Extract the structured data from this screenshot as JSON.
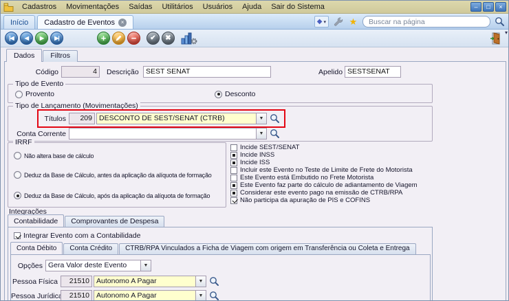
{
  "colors": {
    "menubar_bg": "#d8d3a6",
    "accent_blue": "#2d6cb5",
    "field_yellow": "#ffffce",
    "code_field_bg": "#ece6ec",
    "highlight_red": "#e30613"
  },
  "icons": {
    "combo_arrow": "▼",
    "caret": "▾",
    "diamond": "◆",
    "star": "★"
  },
  "window_controls": {
    "minimize": "–",
    "maximize": "□",
    "close": "×"
  },
  "menu": {
    "items": [
      "Cadastros",
      "Movimentações",
      "Saídas",
      "Utilitários",
      "Usuários",
      "Ajuda",
      "Sair do Sistema"
    ]
  },
  "tabbar": {
    "tabs": [
      {
        "label": "Início"
      },
      {
        "label": "Cadastro de Eventos",
        "close": "×"
      }
    ],
    "search_placeholder": "Buscar na página"
  },
  "toolbar": {
    "nav_first": "|◀",
    "nav_prev": "◀",
    "nav_next": "▶",
    "nav_last": "▶|",
    "add": "+",
    "remove": "−",
    "confirm": "✔",
    "cancel": "✖",
    "overflow_caret": "▾"
  },
  "page_tabs": [
    {
      "label": "Dados",
      "state": "active"
    },
    {
      "label": "Filtros",
      "state": "inactive"
    }
  ],
  "form": {
    "codigo": {
      "label": "Código",
      "value": "4"
    },
    "descricao": {
      "label": "Descrição",
      "value": "SEST SENAT"
    },
    "apelido": {
      "label": "Apelido",
      "value": "SESTSENAT"
    },
    "tipo_evento": {
      "title": "Tipo de Evento",
      "options": [
        {
          "label": "Provento",
          "state": "off"
        },
        {
          "label": "Desconto",
          "state": "on"
        }
      ]
    },
    "tipo_lancamento": {
      "title": "Tipo de Lançamento (Movimentações)",
      "titulos": {
        "label": "Títulos",
        "code": "209",
        "value": "DESCONTO DE SEST/SENAT (CTRB)"
      },
      "conta_corrente": {
        "label": "Conta Corrente",
        "value": ""
      }
    },
    "irrf": {
      "title": "IRRF",
      "options": [
        {
          "label": "Não altera base de cálculo",
          "state": "off"
        },
        {
          "label": "Deduz da Base de Cálculo, antes da aplicação da alíquota de formação",
          "state": "off"
        },
        {
          "label": "Deduz da Base de Cálculo, após da aplicação da alíquota de formação",
          "state": "on"
        }
      ]
    },
    "flags": [
      {
        "label": "Incide SEST/SENAT",
        "state": "unchecked"
      },
      {
        "label": "Incide INSS",
        "state": "filled"
      },
      {
        "label": "Incide ISS",
        "state": "filled"
      },
      {
        "label": "Incluir este Evento no Teste de Limite de Frete do Motorista",
        "state": "unchecked"
      },
      {
        "label": "Este Evento está Embutido no Frete Motorista",
        "state": "unchecked"
      },
      {
        "label": "Este Evento faz parte do cálculo de adiantamento de Viagem",
        "state": "filled"
      },
      {
        "label": "Considerar este evento pago na emissão de CTRB/RPA",
        "state": "filled"
      },
      {
        "label": "Não participa da apuração de PIS e COFINS",
        "state": "checked"
      }
    ]
  },
  "integracoes": {
    "title": "Integrações",
    "tabs": [
      {
        "label": "Contabilidade",
        "state": "active"
      },
      {
        "label": "Comprovantes de Despesa",
        "state": "inactive"
      }
    ],
    "integrar_checkbox": {
      "label": "Integrar Evento com a Contabilidade",
      "state": "checked"
    },
    "subtabs": [
      {
        "label": "Conta Débito",
        "state": "active"
      },
      {
        "label": "Conta Crédito",
        "state": "inactive"
      },
      {
        "label": "CTRB/RPA Vinculados a Ficha de Viagem com origem em Transferência ou Coleta e Entrega",
        "state": "inactive"
      }
    ],
    "opcoes": {
      "label": "Opções",
      "value": "Gera Valor deste Evento"
    },
    "pessoa_fisica": {
      "label": "Pessoa Física",
      "code": "21510",
      "value": "Autonomo A Pagar"
    },
    "pessoa_juridica": {
      "label": "Pessoa Jurídica",
      "code": "21510",
      "value": "Autonomo A Pagar"
    }
  }
}
